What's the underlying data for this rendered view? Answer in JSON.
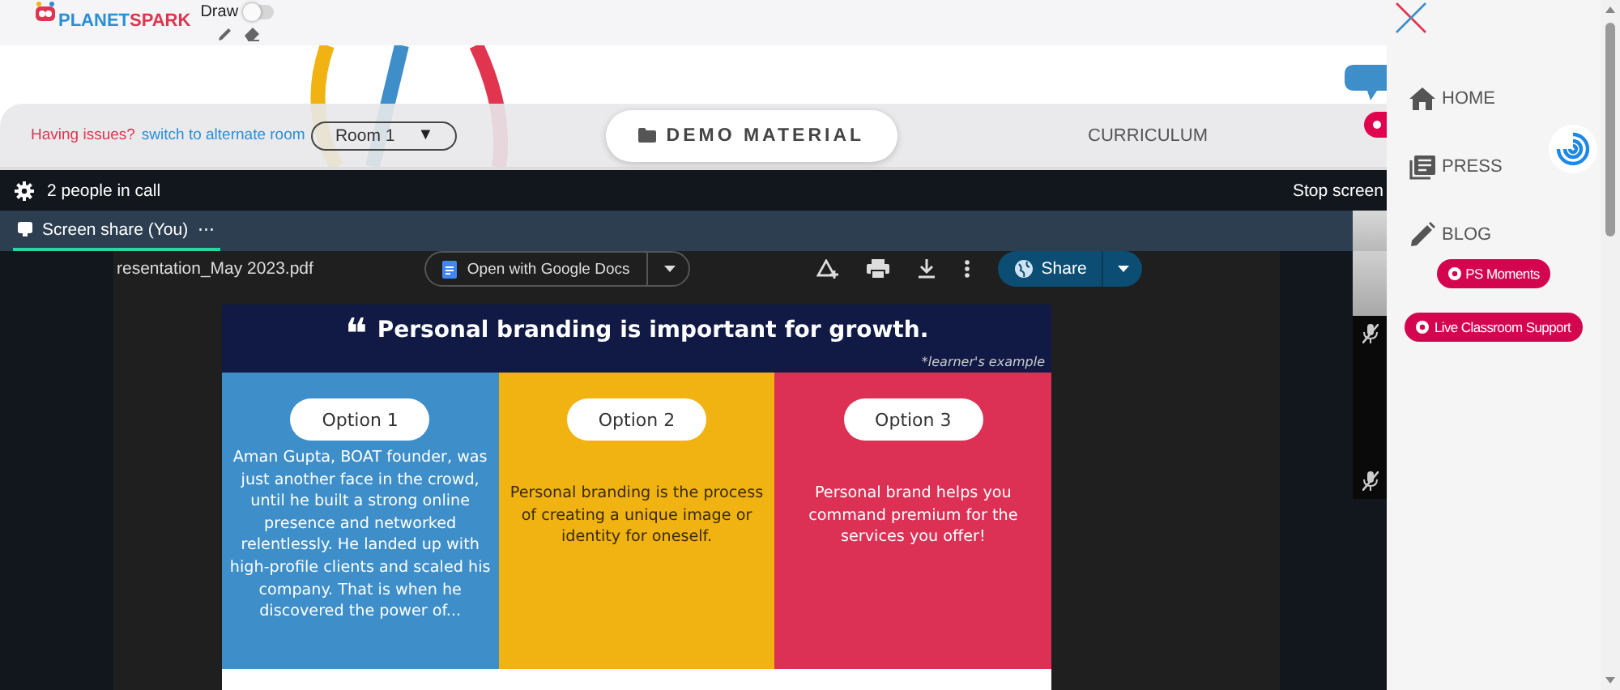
{
  "app": {
    "logo_first": "PLANET",
    "logo_second": "SPARK",
    "draw_label": "Draw",
    "draw_on": false
  },
  "room_bar": {
    "issue_text": "Having issues?",
    "switch_link": "switch to alternate room",
    "room": "Room 1",
    "room_caret": "▼",
    "tabs": [
      {
        "label": "DEMO MATERIAL",
        "selected": true
      },
      {
        "label": "CURRICULUM",
        "selected": false
      }
    ]
  },
  "call": {
    "people": "2 people in call",
    "stop": "Stop screen",
    "tab": {
      "label": "Screen share (You)",
      "selected": true
    },
    "more": "⋯"
  },
  "pdf": {
    "file": "resentation_May 2023.pdf",
    "open_with": "Open with Google Docs",
    "share": "Share"
  },
  "slide": {
    "quote": "❝",
    "title": "Personal branding is important for growth.",
    "note": "*learner's example",
    "options": [
      {
        "label": "Option 1",
        "text": "Aman Gupta, BOAT founder, was just another face in the crowd, until he built a strong online presence and networked relentlessly. He landed up with high-profile clients and scaled his company. That is when he discovered the power of...",
        "color": "#3d8ec9"
      },
      {
        "label": "Option 2",
        "text": "Personal branding is the process of creating a unique image or identity for oneself.",
        "color": "#f0b311"
      },
      {
        "label": "Option 3",
        "text": "Personal brand helps you command premium for the services you offer!",
        "color": "#dc3055"
      }
    ]
  },
  "sidebar": {
    "nav": [
      {
        "label": "HOME"
      },
      {
        "label": "PRESS"
      },
      {
        "label": "BLOG"
      }
    ],
    "buttons": [
      {
        "label": "PS Moments"
      },
      {
        "label": "Live Classroom Support"
      }
    ]
  }
}
